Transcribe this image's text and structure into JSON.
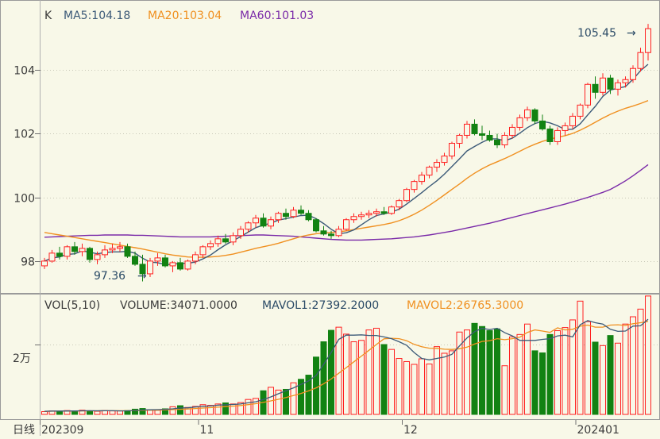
{
  "colors": {
    "background": "#f8f8e8",
    "frame": "#9a9a9a",
    "text": "#3a3a3a",
    "up": "#ff2020",
    "down": "#128212",
    "ma5": "#3c5a78",
    "ma20": "#f09020",
    "ma60": "#7a2aa8"
  },
  "legend": {
    "k_label": "K",
    "ma5": "MA5:104.18",
    "ma20": "MA20:103.04",
    "ma60": "MA60:101.03"
  },
  "volume_legend": {
    "prefix": "VOL(5,10)",
    "volume": "VOLUME:34071.0000",
    "mavol1": "MAVOL1:27392.2000",
    "mavol2": "MAVOL2:26765.3000"
  },
  "annotations": {
    "high": "105.45",
    "low": "97.36"
  },
  "period_label": "日线",
  "chart_data": [
    {
      "type": "candlestick",
      "title": "",
      "x_labels": [
        "202309",
        "11",
        "12",
        "202401"
      ],
      "x_label_index": [
        0,
        21,
        48,
        71
      ],
      "ylim": [
        97.0,
        106.2
      ],
      "y_ticks": [
        98,
        100,
        102,
        104
      ],
      "ohlc": [
        [
          97.85,
          98.1,
          97.75,
          98.0
        ],
        [
          98.0,
          98.35,
          97.95,
          98.25
        ],
        [
          98.25,
          98.45,
          98.05,
          98.15
        ],
        [
          98.15,
          98.5,
          98.05,
          98.45
        ],
        [
          98.45,
          98.6,
          98.2,
          98.3
        ],
        [
          98.3,
          98.55,
          98.15,
          98.4
        ],
        [
          98.4,
          98.45,
          97.95,
          98.05
        ],
        [
          98.05,
          98.3,
          97.9,
          98.2
        ],
        [
          98.2,
          98.5,
          98.1,
          98.35
        ],
        [
          98.35,
          98.55,
          98.25,
          98.4
        ],
        [
          98.4,
          98.6,
          98.3,
          98.45
        ],
        [
          98.45,
          98.55,
          98.1,
          98.15
        ],
        [
          98.15,
          98.3,
          97.85,
          97.9
        ],
        [
          97.9,
          98.2,
          97.36,
          97.6
        ],
        [
          97.6,
          98.1,
          97.5,
          98.0
        ],
        [
          98.0,
          98.25,
          97.85,
          98.1
        ],
        [
          98.1,
          98.2,
          97.8,
          97.85
        ],
        [
          97.85,
          98.0,
          97.65,
          97.95
        ],
        [
          97.95,
          98.1,
          97.7,
          97.75
        ],
        [
          97.75,
          98.05,
          97.7,
          98.0
        ],
        [
          98.0,
          98.3,
          97.9,
          98.2
        ],
        [
          98.2,
          98.5,
          98.1,
          98.45
        ],
        [
          98.45,
          98.65,
          98.35,
          98.55
        ],
        [
          98.55,
          98.8,
          98.45,
          98.7
        ],
        [
          98.7,
          98.85,
          98.55,
          98.6
        ],
        [
          98.6,
          98.9,
          98.5,
          98.8
        ],
        [
          98.8,
          99.1,
          98.7,
          99.0
        ],
        [
          99.0,
          99.25,
          98.9,
          99.2
        ],
        [
          99.2,
          99.45,
          99.05,
          99.35
        ],
        [
          99.35,
          99.5,
          99.05,
          99.1
        ],
        [
          99.1,
          99.4,
          99.0,
          99.3
        ],
        [
          99.3,
          99.55,
          99.2,
          99.5
        ],
        [
          99.5,
          99.65,
          99.3,
          99.4
        ],
        [
          99.4,
          99.7,
          99.35,
          99.6
        ],
        [
          99.6,
          99.75,
          99.45,
          99.5
        ],
        [
          99.5,
          99.6,
          99.25,
          99.3
        ],
        [
          99.3,
          99.35,
          98.9,
          98.95
        ],
        [
          98.95,
          99.1,
          98.8,
          98.85
        ],
        [
          98.85,
          98.95,
          98.7,
          98.8
        ],
        [
          98.8,
          99.1,
          98.75,
          99.0
        ],
        [
          99.0,
          99.35,
          98.95,
          99.3
        ],
        [
          99.3,
          99.5,
          99.2,
          99.4
        ],
        [
          99.4,
          99.55,
          99.3,
          99.45
        ],
        [
          99.45,
          99.6,
          99.35,
          99.5
        ],
        [
          99.5,
          99.65,
          99.4,
          99.55
        ],
        [
          99.55,
          99.7,
          99.45,
          99.5
        ],
        [
          99.5,
          99.75,
          99.45,
          99.7
        ],
        [
          99.7,
          99.95,
          99.6,
          99.9
        ],
        [
          99.9,
          100.3,
          99.85,
          100.25
        ],
        [
          100.25,
          100.55,
          100.15,
          100.5
        ],
        [
          100.5,
          100.8,
          100.4,
          100.7
        ],
        [
          100.7,
          101.0,
          100.6,
          100.95
        ],
        [
          100.95,
          101.2,
          100.8,
          101.1
        ],
        [
          101.1,
          101.4,
          101.0,
          101.3
        ],
        [
          101.3,
          101.75,
          101.2,
          101.7
        ],
        [
          101.7,
          102.0,
          101.55,
          101.95
        ],
        [
          101.95,
          102.4,
          101.85,
          102.3
        ],
        [
          102.3,
          102.45,
          101.95,
          102.0
        ],
        [
          102.0,
          102.25,
          101.8,
          101.95
        ],
        [
          101.95,
          102.1,
          101.75,
          101.8
        ],
        [
          101.8,
          102.0,
          101.55,
          101.65
        ],
        [
          101.65,
          102.05,
          101.55,
          101.95
        ],
        [
          101.95,
          102.3,
          101.85,
          102.2
        ],
        [
          102.2,
          102.6,
          102.1,
          102.5
        ],
        [
          102.5,
          102.85,
          102.4,
          102.75
        ],
        [
          102.75,
          102.8,
          102.3,
          102.4
        ],
        [
          102.4,
          102.6,
          102.1,
          102.15
        ],
        [
          102.15,
          102.25,
          101.65,
          101.75
        ],
        [
          101.75,
          102.2,
          101.65,
          102.1
        ],
        [
          102.1,
          102.35,
          101.95,
          102.25
        ],
        [
          102.25,
          102.65,
          102.15,
          102.55
        ],
        [
          102.55,
          102.95,
          102.45,
          102.9
        ],
        [
          102.9,
          103.6,
          102.8,
          103.55
        ],
        [
          103.55,
          103.8,
          103.1,
          103.3
        ],
        [
          103.3,
          103.9,
          103.2,
          103.75
        ],
        [
          103.75,
          103.85,
          103.25,
          103.4
        ],
        [
          103.4,
          103.7,
          103.2,
          103.6
        ],
        [
          103.6,
          103.8,
          103.45,
          103.7
        ],
        [
          103.7,
          104.15,
          103.6,
          104.05
        ],
        [
          104.05,
          104.7,
          103.95,
          104.55
        ],
        [
          104.55,
          105.45,
          104.3,
          105.3
        ]
      ],
      "ma5": [
        98.0,
        98.1,
        98.13,
        98.21,
        98.23,
        98.32,
        98.28,
        98.23,
        98.27,
        98.29,
        98.29,
        98.31,
        98.25,
        98.09,
        97.97,
        97.95,
        97.89,
        97.9,
        97.93,
        97.93,
        97.97,
        98.07,
        98.19,
        98.36,
        98.51,
        98.64,
        98.77,
        98.91,
        99.05,
        99.13,
        99.19,
        99.29,
        99.33,
        99.38,
        99.43,
        99.44,
        99.33,
        99.18,
        99.0,
        98.86,
        98.89,
        98.98,
        99.14,
        99.3,
        99.43,
        99.48,
        99.54,
        99.63,
        99.79,
        99.97,
        100.15,
        100.34,
        100.52,
        100.73,
        100.97,
        101.21,
        101.46,
        101.6,
        101.73,
        101.84,
        101.84,
        101.78,
        101.86,
        102.02,
        102.19,
        102.32,
        102.39,
        102.34,
        102.25,
        102.13,
        102.14,
        102.31,
        102.59,
        102.86,
        103.17,
        103.37,
        103.43,
        103.48,
        103.71,
        103.98,
        104.18
      ],
      "ma20": [
        98.9,
        98.86,
        98.82,
        98.78,
        98.74,
        98.7,
        98.66,
        98.62,
        98.58,
        98.54,
        98.5,
        98.46,
        98.42,
        98.38,
        98.33,
        98.28,
        98.23,
        98.19,
        98.16,
        98.13,
        98.12,
        98.12,
        98.13,
        98.15,
        98.18,
        98.22,
        98.28,
        98.34,
        98.4,
        98.45,
        98.5,
        98.56,
        98.63,
        98.7,
        98.77,
        98.82,
        98.86,
        98.88,
        98.9,
        98.92,
        98.95,
        98.99,
        99.03,
        99.07,
        99.11,
        99.15,
        99.2,
        99.27,
        99.36,
        99.47,
        99.6,
        99.75,
        99.91,
        100.08,
        100.25,
        100.42,
        100.6,
        100.76,
        100.9,
        101.02,
        101.12,
        101.22,
        101.33,
        101.45,
        101.57,
        101.67,
        101.76,
        101.83,
        101.89,
        101.94,
        102.01,
        102.11,
        102.23,
        102.36,
        102.49,
        102.61,
        102.71,
        102.8,
        102.87,
        102.95,
        103.04
      ],
      "ma60": [
        98.75,
        98.76,
        98.77,
        98.78,
        98.79,
        98.8,
        98.81,
        98.81,
        98.82,
        98.82,
        98.82,
        98.82,
        98.81,
        98.81,
        98.8,
        98.79,
        98.78,
        98.77,
        98.76,
        98.76,
        98.76,
        98.76,
        98.76,
        98.77,
        98.78,
        98.79,
        98.8,
        98.81,
        98.82,
        98.82,
        98.81,
        98.8,
        98.79,
        98.78,
        98.76,
        98.74,
        98.72,
        98.7,
        98.68,
        98.67,
        98.66,
        98.66,
        98.66,
        98.67,
        98.68,
        98.69,
        98.7,
        98.72,
        98.74,
        98.76,
        98.79,
        98.82,
        98.86,
        98.9,
        98.94,
        98.99,
        99.04,
        99.09,
        99.14,
        99.19,
        99.25,
        99.31,
        99.37,
        99.43,
        99.49,
        99.55,
        99.61,
        99.67,
        99.73,
        99.79,
        99.86,
        99.93,
        100.0,
        100.08,
        100.16,
        100.25,
        100.38,
        100.52,
        100.68,
        100.85,
        101.03
      ]
    },
    {
      "type": "bar",
      "title": "",
      "ylabel_tick": "2万",
      "ylim": [
        0,
        34500
      ],
      "y_ticks": [
        20000
      ],
      "values": [
        800,
        1000,
        900,
        1100,
        1000,
        1200,
        1000,
        900,
        1100,
        1000,
        1000,
        1100,
        1500,
        1700,
        1300,
        1200,
        1600,
        2200,
        2500,
        2000,
        2300,
        2800,
        2600,
        3000,
        3300,
        3000,
        3400,
        4300,
        4600,
        6800,
        7800,
        7000,
        7200,
        9100,
        10100,
        11300,
        16500,
        20900,
        24200,
        25100,
        23100,
        20900,
        21300,
        24300,
        24800,
        20100,
        18700,
        16100,
        15200,
        14400,
        16000,
        14500,
        19500,
        17600,
        18300,
        23700,
        24300,
        26200,
        25300,
        24100,
        24600,
        14000,
        22300,
        23000,
        26000,
        18300,
        17700,
        23000,
        24100,
        25000,
        27200,
        32600,
        26700,
        20800,
        19800,
        22700,
        20500,
        26000,
        28100,
        30300,
        34071
      ],
      "mavol1": [
        900,
        950,
        960,
        980,
        990,
        1020,
        1040,
        1020,
        1050,
        1060,
        1000,
        1020,
        1120,
        1280,
        1320,
        1360,
        1460,
        1600,
        1860,
        1900,
        2120,
        2320,
        2420,
        2640,
        2760,
        2860,
        3000,
        3340,
        3640,
        4280,
        5020,
        5940,
        6800,
        7640,
        8640,
        9640,
        11200,
        14400,
        17800,
        21600,
        22800,
        22800,
        22900,
        22700,
        22700,
        22300,
        21800,
        20900,
        19900,
        17800,
        16100,
        15700,
        16100,
        16500,
        17300,
        19700,
        22000,
        23800,
        24800,
        24400,
        24800,
        23500,
        22600,
        21300,
        21300,
        21300,
        21600,
        21800,
        22600,
        22800,
        22300,
        25800,
        27000,
        26400,
        26000,
        24500,
        23900,
        24000,
        25400,
        25500,
        27392
      ],
      "mavol2": [
        900,
        920,
        940,
        960,
        980,
        1000,
        1020,
        1030,
        1040,
        1050,
        1060,
        1060,
        1100,
        1160,
        1200,
        1220,
        1280,
        1370,
        1470,
        1550,
        1680,
        1820,
        1940,
        2080,
        2230,
        2380,
        2560,
        2810,
        3080,
        3460,
        3880,
        4340,
        4850,
        5410,
        6040,
        6770,
        7640,
        8830,
        10200,
        11840,
        13450,
        15120,
        16770,
        18440,
        20130,
        21750,
        21900,
        21800,
        21200,
        20150,
        19500,
        19050,
        19000,
        18750,
        18700,
        18900,
        19350,
        20250,
        21000,
        21200,
        21800,
        21500,
        21800,
        22200,
        23600,
        24300,
        24000,
        23600,
        24900,
        24300,
        24500,
        25400,
        25700,
        25100,
        25100,
        25700,
        25800,
        25600,
        26100,
        26400,
        26765
      ]
    }
  ]
}
